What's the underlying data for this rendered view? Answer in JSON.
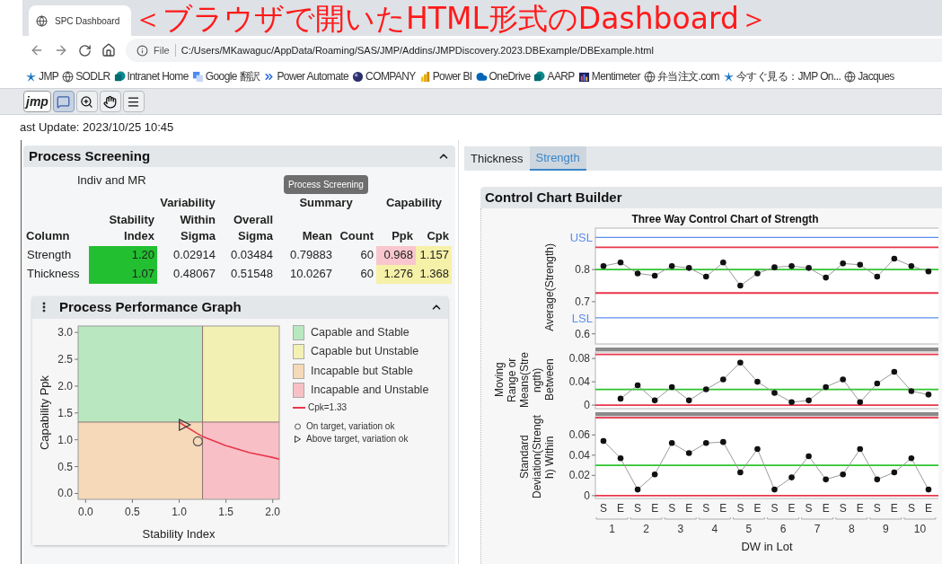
{
  "annotation": {
    "text": "＜ブラウザで開いたHTML形式のDashboard＞"
  },
  "browser": {
    "tab_title": "SPC Dashboard",
    "scheme": "File",
    "url": "C:/Users/MKawaguc/AppData/Roaming/SAS/JMP/Addins/JMPDiscovery.2023.DBExample/DBExample.html",
    "bookmarks": [
      {
        "label": "JMP",
        "kind": "jmp"
      },
      {
        "label": "SODLR",
        "kind": "globe"
      },
      {
        "label": "Intranet Home",
        "kind": "sharepoint"
      },
      {
        "label": "Google 翻訳",
        "kind": "translate"
      },
      {
        "label": "Power Automate",
        "kind": "automate"
      },
      {
        "label": "COMPANY",
        "kind": "sphere"
      },
      {
        "label": "Power BI",
        "kind": "powerbi"
      },
      {
        "label": "OneDrive",
        "kind": "cloud"
      },
      {
        "label": "AARP",
        "kind": "sharepoint"
      },
      {
        "label": "Mentimeter",
        "kind": "menti"
      },
      {
        "label": "弁当注文.com",
        "kind": "globe"
      },
      {
        "label": "今すぐ見る：JMP On...",
        "kind": "jmp"
      },
      {
        "label": "Jacques",
        "kind": "globe"
      }
    ]
  },
  "toolbar": {
    "logo": "jmp",
    "tools": [
      {
        "kind": "annotate",
        "selected": true
      },
      {
        "kind": "zoom",
        "selected": false
      },
      {
        "kind": "hand",
        "selected": false
      },
      {
        "kind": "menu",
        "selected": false
      }
    ]
  },
  "last_update": "ast Update: 2023/10/25 10:45",
  "screening": {
    "title": "Process Screening",
    "expanded": true,
    "subtitle": "Indiv and MR",
    "tooltip": "Process Screening",
    "groups": [
      "Variability",
      "Summary",
      "Capability"
    ],
    "columns": [
      "Column",
      "Stability\nIndex",
      "Within\nSigma",
      "Overall\nSigma",
      "Mean",
      "Count",
      "Ppk",
      "Cpk"
    ],
    "rows": [
      {
        "cells": [
          {
            "text": "Strength"
          },
          {
            "text": "1.20",
            "color": "#22bf31"
          },
          {
            "text": "0.02914"
          },
          {
            "text": "0.03484"
          },
          {
            "text": "0.79883"
          },
          {
            "text": "60"
          },
          {
            "text": "0.968",
            "color": "#f8c6cc"
          },
          {
            "text": "1.157",
            "color": "#f6f1a8"
          }
        ]
      },
      {
        "cells": [
          {
            "text": "Thickness"
          },
          {
            "text": "1.07",
            "color": "#22bf31"
          },
          {
            "text": "0.48067"
          },
          {
            "text": "0.51548"
          },
          {
            "text": "10.0267"
          },
          {
            "text": "60"
          },
          {
            "text": "1.276",
            "color": "#f6f1a8"
          },
          {
            "text": "1.368",
            "color": "#f6f1a8"
          }
        ]
      }
    ]
  },
  "performance": {
    "title": "Process Performance Graph",
    "expanded": true,
    "quadrants": [
      {
        "label": "Capable and Stable",
        "color": "#b9e8c0"
      },
      {
        "label": "Capable but Unstable",
        "color": "#f3f0b4"
      },
      {
        "label": "Incapable but Stable",
        "color": "#f6d9b8"
      },
      {
        "label": "Incapable and Unstable",
        "color": "#f8c0c6"
      }
    ],
    "chart_data": {
      "type": "line",
      "xlabel": "Stability Index",
      "ylabel": "Capability Ppk",
      "x": [
        1.0,
        1.05,
        1.2,
        1.25,
        1.5,
        1.75,
        2.0,
        2.07
      ],
      "series": [
        {
          "name": "Cpk=1.33",
          "color": "#e8374b",
          "values": [
            1.33,
            1.27,
            1.11,
            1.06,
            0.89,
            0.76,
            0.67,
            0.64
          ]
        },
        {
          "name": "On target, variation ok",
          "marker": "circle",
          "color": "#555555",
          "values": [
            null,
            null,
            0.97,
            null,
            null,
            null,
            null,
            null
          ]
        },
        {
          "name": "Above target, variation ok",
          "marker": "triangle",
          "color": "#333333",
          "values": [
            null,
            1.28,
            null,
            null,
            null,
            null,
            null,
            null
          ]
        }
      ],
      "xlim": [
        -0.08,
        2.07
      ],
      "ylim": [
        -0.11,
        3.12
      ],
      "xticks": [
        {
          "value": 0,
          "label": "0.0"
        },
        {
          "value": 0.5,
          "label": "0.5"
        },
        {
          "value": 1,
          "label": "1.0"
        },
        {
          "value": 1.5,
          "label": "1.5"
        },
        {
          "value": 2,
          "label": "2.0"
        }
      ],
      "yticks": [
        {
          "value": 0,
          "label": "0.0"
        },
        {
          "value": 0.5,
          "label": "0.5"
        },
        {
          "value": 1,
          "label": "1.0"
        },
        {
          "value": 1.5,
          "label": "1.5"
        },
        {
          "value": 2,
          "label": "2.0"
        },
        {
          "value": 2.5,
          "label": "2.5"
        },
        {
          "value": 3,
          "label": "3.0"
        }
      ],
      "ref_lines": [
        {
          "axis": "x",
          "value": 1.25,
          "color": "#8c7070"
        },
        {
          "axis": "y",
          "value": 1.33,
          "color": "#8c7070"
        }
      ]
    }
  },
  "tabs": [
    {
      "label": "Thickness",
      "selected": false
    },
    {
      "label": "Strength",
      "selected": true
    }
  ],
  "control_chart": {
    "title": "Control Chart Builder",
    "chart_title": "Three Way Control Chart of Strength",
    "groups": [
      "1",
      "2",
      "3",
      "4",
      "5",
      "6",
      "7",
      "8",
      "9",
      "10"
    ],
    "panels": [
      {
        "chart_data": {
          "type": "line",
          "ylabel": "Average(Strength)",
          "ylim": [
            0.574,
            0.929
          ],
          "yticks": [
            0.6,
            0.7,
            0.8
          ],
          "series": [
            {
              "marker": "circle",
              "color": "#111111",
              "values": [
                0.811,
                0.822,
                0.788,
                0.781,
                0.811,
                0.805,
                0.778,
                0.822,
                0.75,
                0.788,
                0.807,
                0.811,
                0.805,
                0.775,
                0.819,
                0.815,
                0.778,
                0.834,
                0.811,
                0.794
              ]
            }
          ],
          "ref_lines": [
            {
              "axis": "y",
              "value": 0.9,
              "label": "USL",
              "color": "#5b8def"
            },
            {
              "axis": "y",
              "value": 0.869,
              "color": "#e8374b"
            },
            {
              "axis": "y",
              "value": 0.8,
              "color": "#2ec42e"
            },
            {
              "axis": "y",
              "value": 0.727,
              "color": "#e8374b"
            },
            {
              "axis": "y",
              "value": 0.65,
              "label": "LSL",
              "color": "#5b8def"
            }
          ]
        }
      },
      {
        "chart_data": {
          "type": "line",
          "ylabel": "Moving Range or Means(Strength) Between",
          "ylim": [
            -0.003,
            0.091
          ],
          "yticks": [
            0,
            0.04,
            0.08
          ],
          "series": [
            {
              "marker": "circle",
              "color": "#111111",
              "values": [
                null,
                0.011,
                0.034,
                0.008,
                0.031,
                0.008,
                0.027,
                0.044,
                0.073,
                0.04,
                0.021,
                0.005,
                0.008,
                0.031,
                0.044,
                0.005,
                0.037,
                0.057,
                0.024,
                0.018
              ]
            }
          ],
          "ref_lines": [
            {
              "axis": "y",
              "value": 0.087,
              "color": "#e8374b"
            },
            {
              "axis": "y",
              "value": 0.027,
              "color": "#2ec42e"
            },
            {
              "axis": "y",
              "value": 0,
              "color": "#e8374b"
            }
          ]
        }
      },
      {
        "chart_data": {
          "type": "line",
          "ylabel": "Standard Deviation(Strength) Within",
          "xlabel": "DW in Lot",
          "ylim": [
            -0.001,
            0.078
          ],
          "yticks": [
            0,
            0.02,
            0.04,
            0.06
          ],
          "categories": [
            "S",
            "E",
            "S",
            "E",
            "S",
            "E",
            "S",
            "E",
            "S",
            "E",
            "S",
            "E",
            "S",
            "E",
            "S",
            "E",
            "S",
            "E",
            "S",
            "E"
          ],
          "series": [
            {
              "marker": "circle",
              "color": "#111111",
              "values": [
                0.054,
                0.037,
                0.006,
                0.021,
                0.052,
                0.042,
                0.052,
                0.053,
                0.023,
                0.046,
                0.006,
                0.018,
                0.039,
                0.016,
                0.021,
                0.046,
                0.016,
                0.023,
                0.037,
                0.006
              ]
            }
          ],
          "ref_lines": [
            {
              "axis": "y",
              "value": 0.077,
              "color": "#e8374b"
            },
            {
              "axis": "y",
              "value": 0.03,
              "color": "#2ec42e"
            },
            {
              "axis": "y",
              "value": 0,
              "color": "#e8374b"
            }
          ]
        }
      }
    ]
  }
}
